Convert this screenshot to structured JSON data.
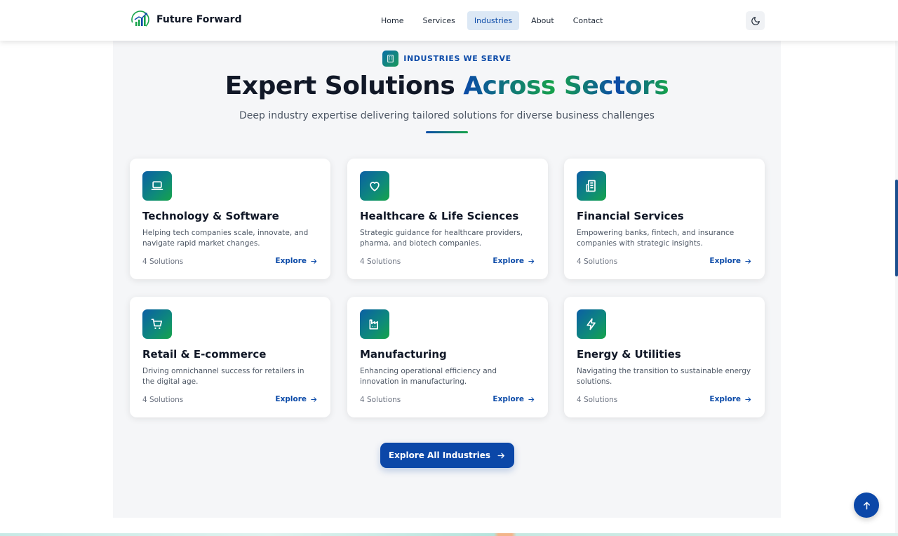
{
  "header": {
    "brand": "Future Forward",
    "nav": [
      {
        "label": "Home",
        "active": false
      },
      {
        "label": "Services",
        "active": false
      },
      {
        "label": "Industries",
        "active": true
      },
      {
        "label": "About",
        "active": false
      },
      {
        "label": "Contact",
        "active": false
      }
    ],
    "theme_toggle_icon": "moon-icon"
  },
  "hero": {
    "eyebrow": "INDUSTRIES WE SERVE",
    "eyebrow_icon": "building-icon",
    "title_plain": "Expert Solutions",
    "title_highlight": "Across Sectors",
    "subtitle": "Deep industry expertise delivering tailored solutions for diverse business challenges"
  },
  "industries": [
    {
      "icon": "laptop-icon",
      "title": "Technology & Software",
      "description": "Helping tech companies scale, innovate, and navigate rapid market changes.",
      "count": "4 Solutions",
      "link": "Explore"
    },
    {
      "icon": "heart-icon",
      "title": "Healthcare & Life Sciences",
      "description": "Strategic guidance for healthcare providers, pharma, and biotech companies.",
      "count": "4 Solutions",
      "link": "Explore"
    },
    {
      "icon": "building-icon",
      "title": "Financial Services",
      "description": "Empowering banks, fintech, and insurance companies with strategic insights.",
      "count": "4 Solutions",
      "link": "Explore"
    },
    {
      "icon": "shopping-cart-icon",
      "title": "Retail & E-commerce",
      "description": "Driving omnichannel success for retailers in the digital age.",
      "count": "4 Solutions",
      "link": "Explore"
    },
    {
      "icon": "factory-icon",
      "title": "Manufacturing",
      "description": "Enhancing operational efficiency and innovation in manufacturing.",
      "count": "4 Solutions",
      "link": "Explore"
    },
    {
      "icon": "lightning-icon",
      "title": "Energy & Utilities",
      "description": "Navigating the transition to sustainable energy solutions.",
      "count": "4 Solutions",
      "link": "Explore"
    }
  ],
  "cta": {
    "label": "Explore All Industries",
    "icon": "arrow-right-icon"
  },
  "scroll_top_icon": "arrow-up-icon",
  "colors": {
    "primary": "#0b47a8",
    "accent_green": "#16a34a",
    "active_nav_bg": "#dce8f5",
    "section_bg": "#f5f6f8"
  }
}
